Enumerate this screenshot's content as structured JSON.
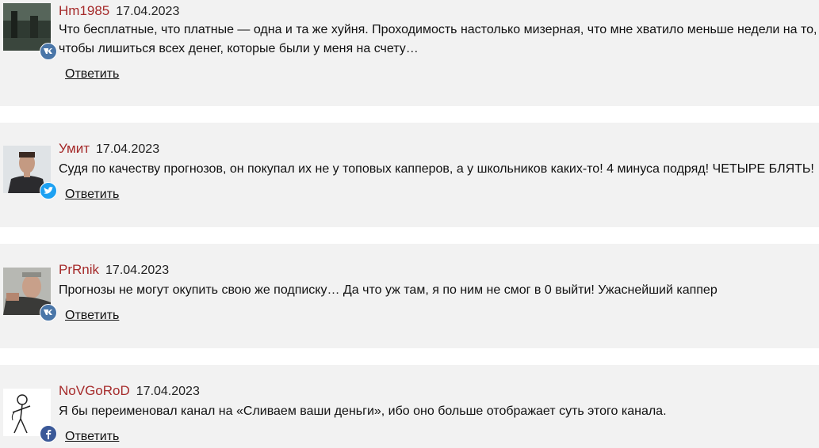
{
  "comments": [
    {
      "author": "Hm1985",
      "date": "17.04.2023",
      "text": "Что бесплатные, что платные — одна и та же хуйня. Проходимость настолько мизерная, что мне хватило меньше недели на то, чтобы лишиться всех денег, которые были у меня на счету…",
      "reply": "Ответить",
      "network": "vk-icon",
      "network_color": "#4a76a8"
    },
    {
      "author": "Умит",
      "date": "17.04.2023",
      "text": "Судя по качеству прогнозов, он покупал их не у топовых капперов, а у школьников каких-то! 4 минуса подряд! ЧЕТЫРЕ БЛЯТЬ!",
      "reply": "Ответить",
      "network": "twitter-icon",
      "network_color": "#1da1f2"
    },
    {
      "author": "PrRnik",
      "date": "17.04.2023",
      "text": "Прогнозы не могут окупить свою же подписку… Да что уж там, я по ним не смог в 0 выйти! Ужаснейший каппер",
      "reply": "Ответить",
      "network": "vk-icon",
      "network_color": "#4a76a8"
    },
    {
      "author": "NoVGoRoD",
      "date": "17.04.2023",
      "text": "Я бы переименовал канал на «Сливаем ваши деньги», ибо оно больше отображает суть этого канала.",
      "reply": "Ответить",
      "network": "facebook-icon",
      "network_color": "#3b5998"
    }
  ]
}
